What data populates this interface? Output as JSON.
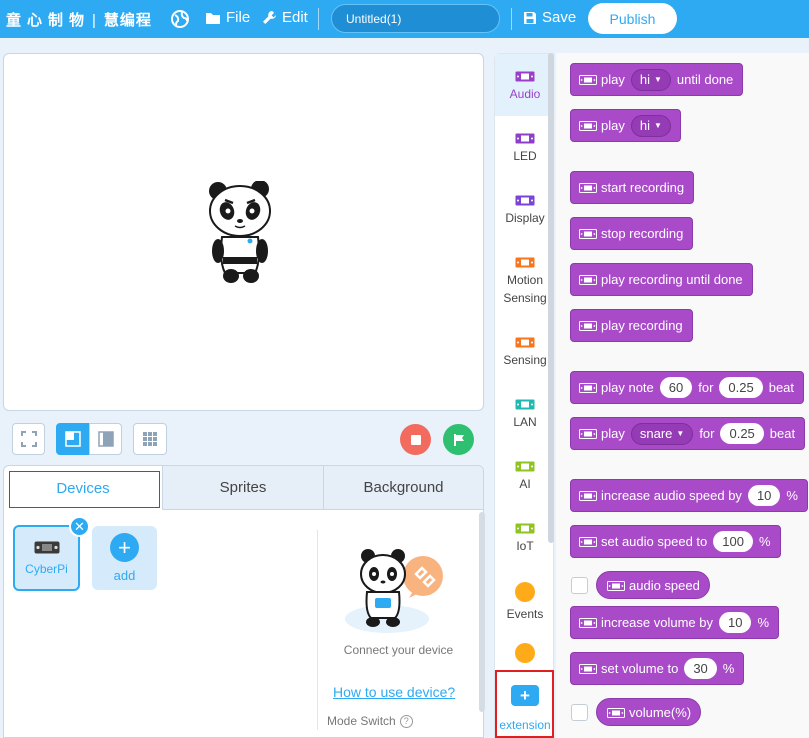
{
  "topbar": {
    "brand_a": "童心制物",
    "brand_b": "慧编程",
    "separator": "|",
    "file_label": "File",
    "edit_label": "Edit",
    "project_name": "Untitled(1)",
    "save_label": "Save",
    "publish_label": "Publish",
    "accent_color": "#2eaaf3"
  },
  "bottom_panel": {
    "tabs": [
      "Devices",
      "Sprites",
      "Background"
    ],
    "active_tab": "Devices",
    "device_label": "CyberPi",
    "close_symbol": "✕",
    "add_symbol": "+",
    "add_label": "add",
    "connect_text": "Connect your device",
    "howto_link": "How to use device?",
    "mode_switch_label": "Mode Switch",
    "help_symbol": "?"
  },
  "categories": {
    "items": [
      "Audio",
      "LED",
      "Display",
      "Motion Sensing",
      "Sensing",
      "LAN",
      "AI",
      "IoT",
      "Events"
    ],
    "active": "Audio",
    "extension_label": "extension",
    "extension_symbol": "+"
  },
  "blocks": {
    "b1": {
      "a": "play",
      "drop": "hi",
      "b": "until done"
    },
    "b2": {
      "a": "play",
      "drop": "hi"
    },
    "b3": "start recording",
    "b4": "stop recording",
    "b5": "play recording until done",
    "b6": "play recording",
    "b7": {
      "a": "play note",
      "note": "60",
      "b": "for",
      "beat": "0.25",
      "c": "beat"
    },
    "b8": {
      "a": "play",
      "drop": "snare",
      "b": "for",
      "beat": "0.25",
      "c": "beat"
    },
    "b9": {
      "a": "increase audio speed by",
      "val": "10",
      "unit": "%"
    },
    "b10": {
      "a": "set audio speed to",
      "val": "100",
      "unit": "%"
    },
    "b11": "audio speed",
    "b12": {
      "a": "increase volume by",
      "val": "10",
      "unit": "%"
    },
    "b13": {
      "a": "set volume to",
      "val": "30",
      "unit": "%"
    },
    "b14": "volume(%)",
    "block_color": "#a94bc9"
  }
}
